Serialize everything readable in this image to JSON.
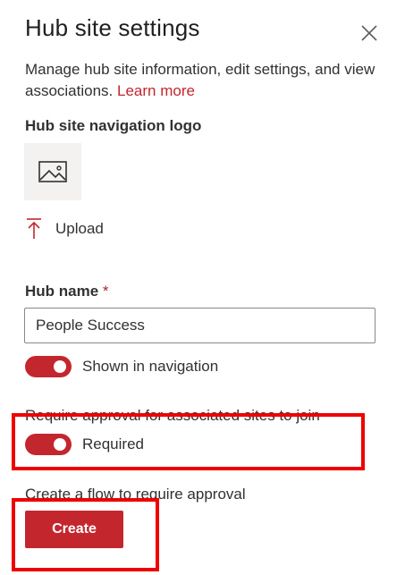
{
  "panel": {
    "title": "Hub site settings",
    "description": "Manage hub site information, edit settings, and view associations.",
    "learn_more": "Learn more"
  },
  "logo": {
    "label": "Hub site navigation logo",
    "placeholder_icon": "image-placeholder-icon",
    "upload_label": "Upload",
    "upload_icon": "upload-arrow-icon"
  },
  "hub_name": {
    "label": "Hub name",
    "required_marker": "*",
    "value": "People Success"
  },
  "navigation_toggle": {
    "label": "Shown in navigation",
    "on": true
  },
  "approval": {
    "label": "Require approval for associated sites to join",
    "toggle_label": "Required",
    "on": true
  },
  "flow": {
    "label": "Create a flow to require approval",
    "button_label": "Create"
  },
  "colors": {
    "accent": "#c4262e",
    "highlight": "#ee0000"
  }
}
